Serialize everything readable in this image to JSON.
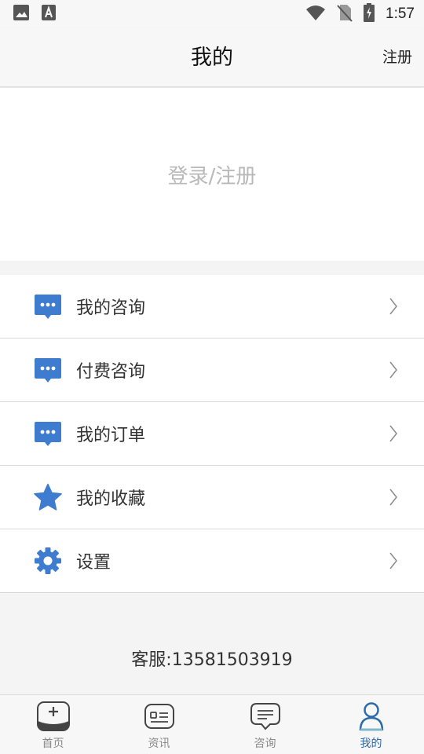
{
  "status_bar": {
    "time": "1:57",
    "icons": [
      "image-icon",
      "a-icon",
      "wifi-icon",
      "no-sim-icon",
      "battery-charging-icon"
    ]
  },
  "header": {
    "title": "我的",
    "register_label": "注册"
  },
  "login": {
    "text": "登录/注册"
  },
  "menu": {
    "items": [
      {
        "label": "我的咨询",
        "icon": "chat-bubble-icon"
      },
      {
        "label": "付费咨询",
        "icon": "chat-bubble-icon"
      },
      {
        "label": "我的订单",
        "icon": "chat-bubble-icon"
      },
      {
        "label": "我的收藏",
        "icon": "star-icon"
      },
      {
        "label": "设置",
        "icon": "gear-icon"
      }
    ],
    "chevron": "〉"
  },
  "service": {
    "text": "客服:13581503919"
  },
  "bottom_nav": {
    "items": [
      {
        "label": "首页",
        "icon": "home-plus-icon",
        "active": false
      },
      {
        "label": "资讯",
        "icon": "news-icon",
        "active": false
      },
      {
        "label": "咨询",
        "icon": "message-icon",
        "active": false
      },
      {
        "label": "我的",
        "icon": "user-icon",
        "active": true
      }
    ]
  },
  "colors": {
    "accent": "#2c6aa8",
    "icon_blue": "#3d7ccf",
    "placeholder": "#b8b8b8"
  }
}
